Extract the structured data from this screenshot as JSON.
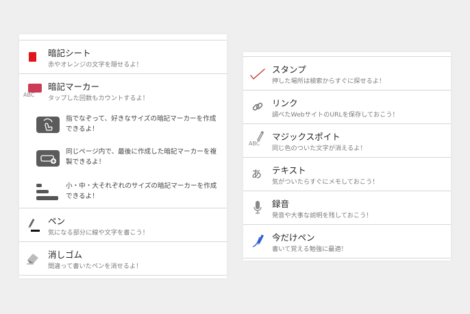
{
  "left": {
    "items": [
      {
        "title": "暗記シート",
        "desc": "赤やオレンジの文字を隠せるよ！",
        "icon": "red-sheet-icon",
        "color": "#e2151a"
      },
      {
        "title": "暗記マーカー",
        "desc": "タップした回数もカウントするよ！",
        "icon": "marker-icon",
        "color": "#cc3b55",
        "abc": "ABC"
      },
      {
        "title": "ペン",
        "desc": "気になる部分に線や文字を書こう！",
        "icon": "pen-icon"
      },
      {
        "title": "消しゴム",
        "desc": "間違って書いたペンを消せるよ！",
        "icon": "eraser-icon"
      }
    ],
    "subitems": [
      {
        "text": "指でなぞって、好きなサイズの暗記マーカーを作成できるよ！",
        "icon": "finger-trace-icon"
      },
      {
        "text": "同じページ内で、最後に作成した暗記マーカーを複製できるよ！",
        "icon": "duplicate-marker-icon"
      },
      {
        "text": "小・中・大それぞれのサイズの暗記マーカーを作成できるよ！",
        "icon": "size-bars-icon"
      }
    ]
  },
  "right": {
    "items": [
      {
        "title": "スタンプ",
        "desc": "押した場所は検索からすぐに探せるよ！",
        "icon": "check-stamp-icon",
        "color": "#c0392b"
      },
      {
        "title": "リンク",
        "desc": "調べたWebサイトのURLを保存しておこう！",
        "icon": "link-icon"
      },
      {
        "title": "マジックスポイト",
        "desc": "同じ色のついた文字が消えるよ！",
        "icon": "eyedropper-icon",
        "abc": "ABC"
      },
      {
        "title": "テキスト",
        "desc": "気がついたらすぐにメモしておこう！",
        "icon": "text-a-icon",
        "glyph": "あ"
      },
      {
        "title": "録音",
        "desc": "発音や大事な説明を残しておこう！",
        "icon": "microphone-icon"
      },
      {
        "title": "今だけペン",
        "desc": "書いて覚える勉強に最適！",
        "icon": "temp-pen-icon",
        "color": "#2c5fd6"
      }
    ]
  }
}
